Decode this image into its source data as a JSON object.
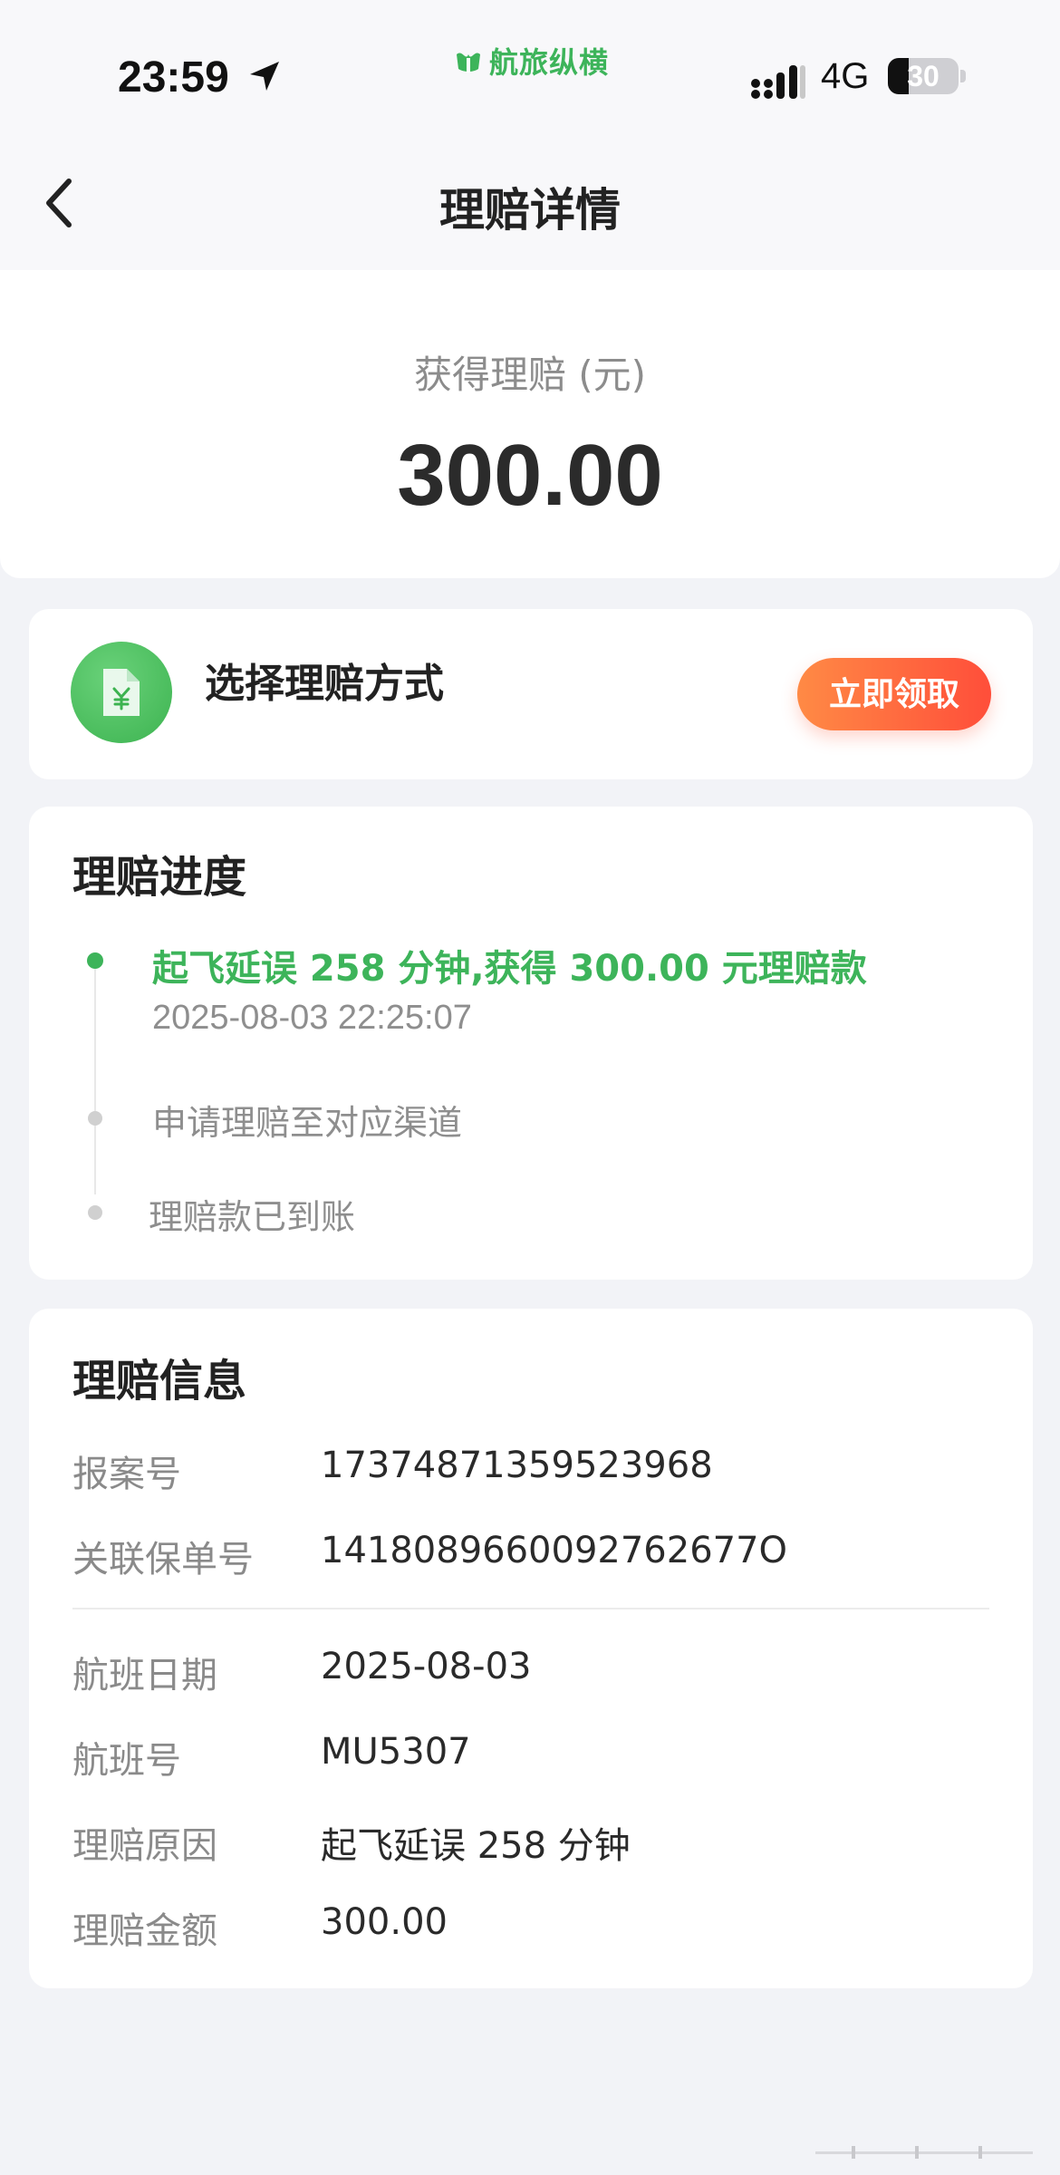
{
  "status_bar": {
    "time": "23:59",
    "brand": "航旅纵横",
    "network": "4G",
    "battery": "30",
    "battery_level": 0.3,
    "icons": [
      "location-arrow-icon",
      "brand-logo-icon",
      "signal-icon",
      "battery-icon"
    ]
  },
  "header": {
    "title": "理赔详情",
    "back_icon": "chevron-left-icon"
  },
  "amount": {
    "label": "获得理赔 (元)",
    "value": "300.00"
  },
  "method": {
    "title": "选择理赔方式",
    "button": "立即领取",
    "icon": "yuan-document-icon"
  },
  "progress": {
    "title": "理赔进度",
    "steps": [
      {
        "text": "起飞延误 258 分钟,获得 300.00 元理赔款",
        "time": "2025-08-03 22:25:07",
        "active": true
      },
      {
        "text": "申请理赔至对应渠道",
        "active": false
      },
      {
        "text": "理赔款已到账",
        "active": false
      }
    ]
  },
  "info": {
    "title": "理赔信息",
    "rows": [
      {
        "label": "报案号",
        "value": "17374871359523968"
      },
      {
        "label": "关联保单号",
        "value": "1418089660092762677O"
      },
      {
        "label": "航班日期",
        "value": "2025-08-03"
      },
      {
        "label": "航班号",
        "value": "MU5307"
      },
      {
        "label": "理赔原因",
        "value": "起飞延误 258 分钟"
      },
      {
        "label": "理赔金额",
        "value": "300.00"
      }
    ]
  },
  "colors": {
    "accent_green": "#3db45a",
    "button_orange": "#ff6a3d",
    "background": "#f2f3f7"
  }
}
